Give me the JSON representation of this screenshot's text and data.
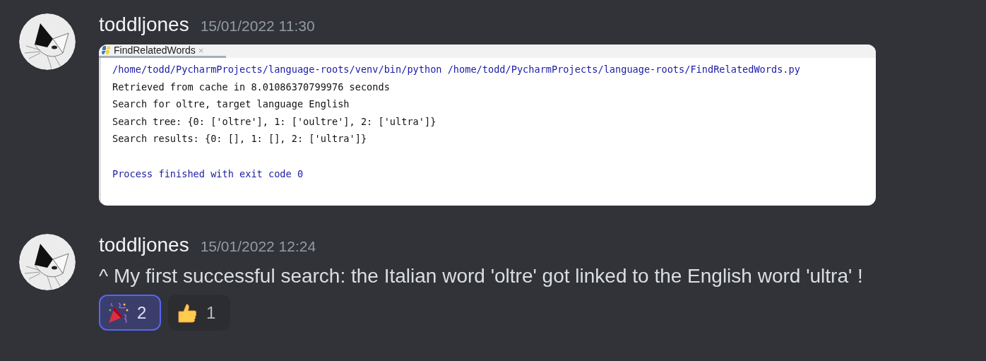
{
  "messages": [
    {
      "author": "toddljones",
      "timestamp": "15/01/2022 11:30",
      "attachment": {
        "kind": "console",
        "tab": {
          "label": "FindRelatedWords",
          "close": "×"
        },
        "lines": [
          {
            "kind": "command",
            "text": "/home/todd/PycharmProjects/language-roots/venv/bin/python /home/todd/PycharmProjects/language-roots/FindRelatedWords.py"
          },
          {
            "kind": "output",
            "text": "Retrieved from cache in 8.01086370799976 seconds"
          },
          {
            "kind": "output",
            "text": "Search for oltre, target language English"
          },
          {
            "kind": "output",
            "text": "Search tree: {0: ['oltre'], 1: ['oultre'], 2: ['ultra']}"
          },
          {
            "kind": "output",
            "text": "Search results: {0: [], 1: [], 2: ['ultra']}"
          },
          {
            "kind": "status",
            "text": "Process finished with exit code 0"
          }
        ]
      }
    },
    {
      "author": "toddljones",
      "timestamp": "15/01/2022 12:24",
      "text": "^ My first successful search: the Italian word 'oltre' got linked to the English word 'ultra' !",
      "reactions": [
        {
          "kind": "party",
          "count": "2",
          "selected": true
        },
        {
          "kind": "thumbs",
          "count": "1",
          "selected": false
        }
      ]
    }
  ]
}
